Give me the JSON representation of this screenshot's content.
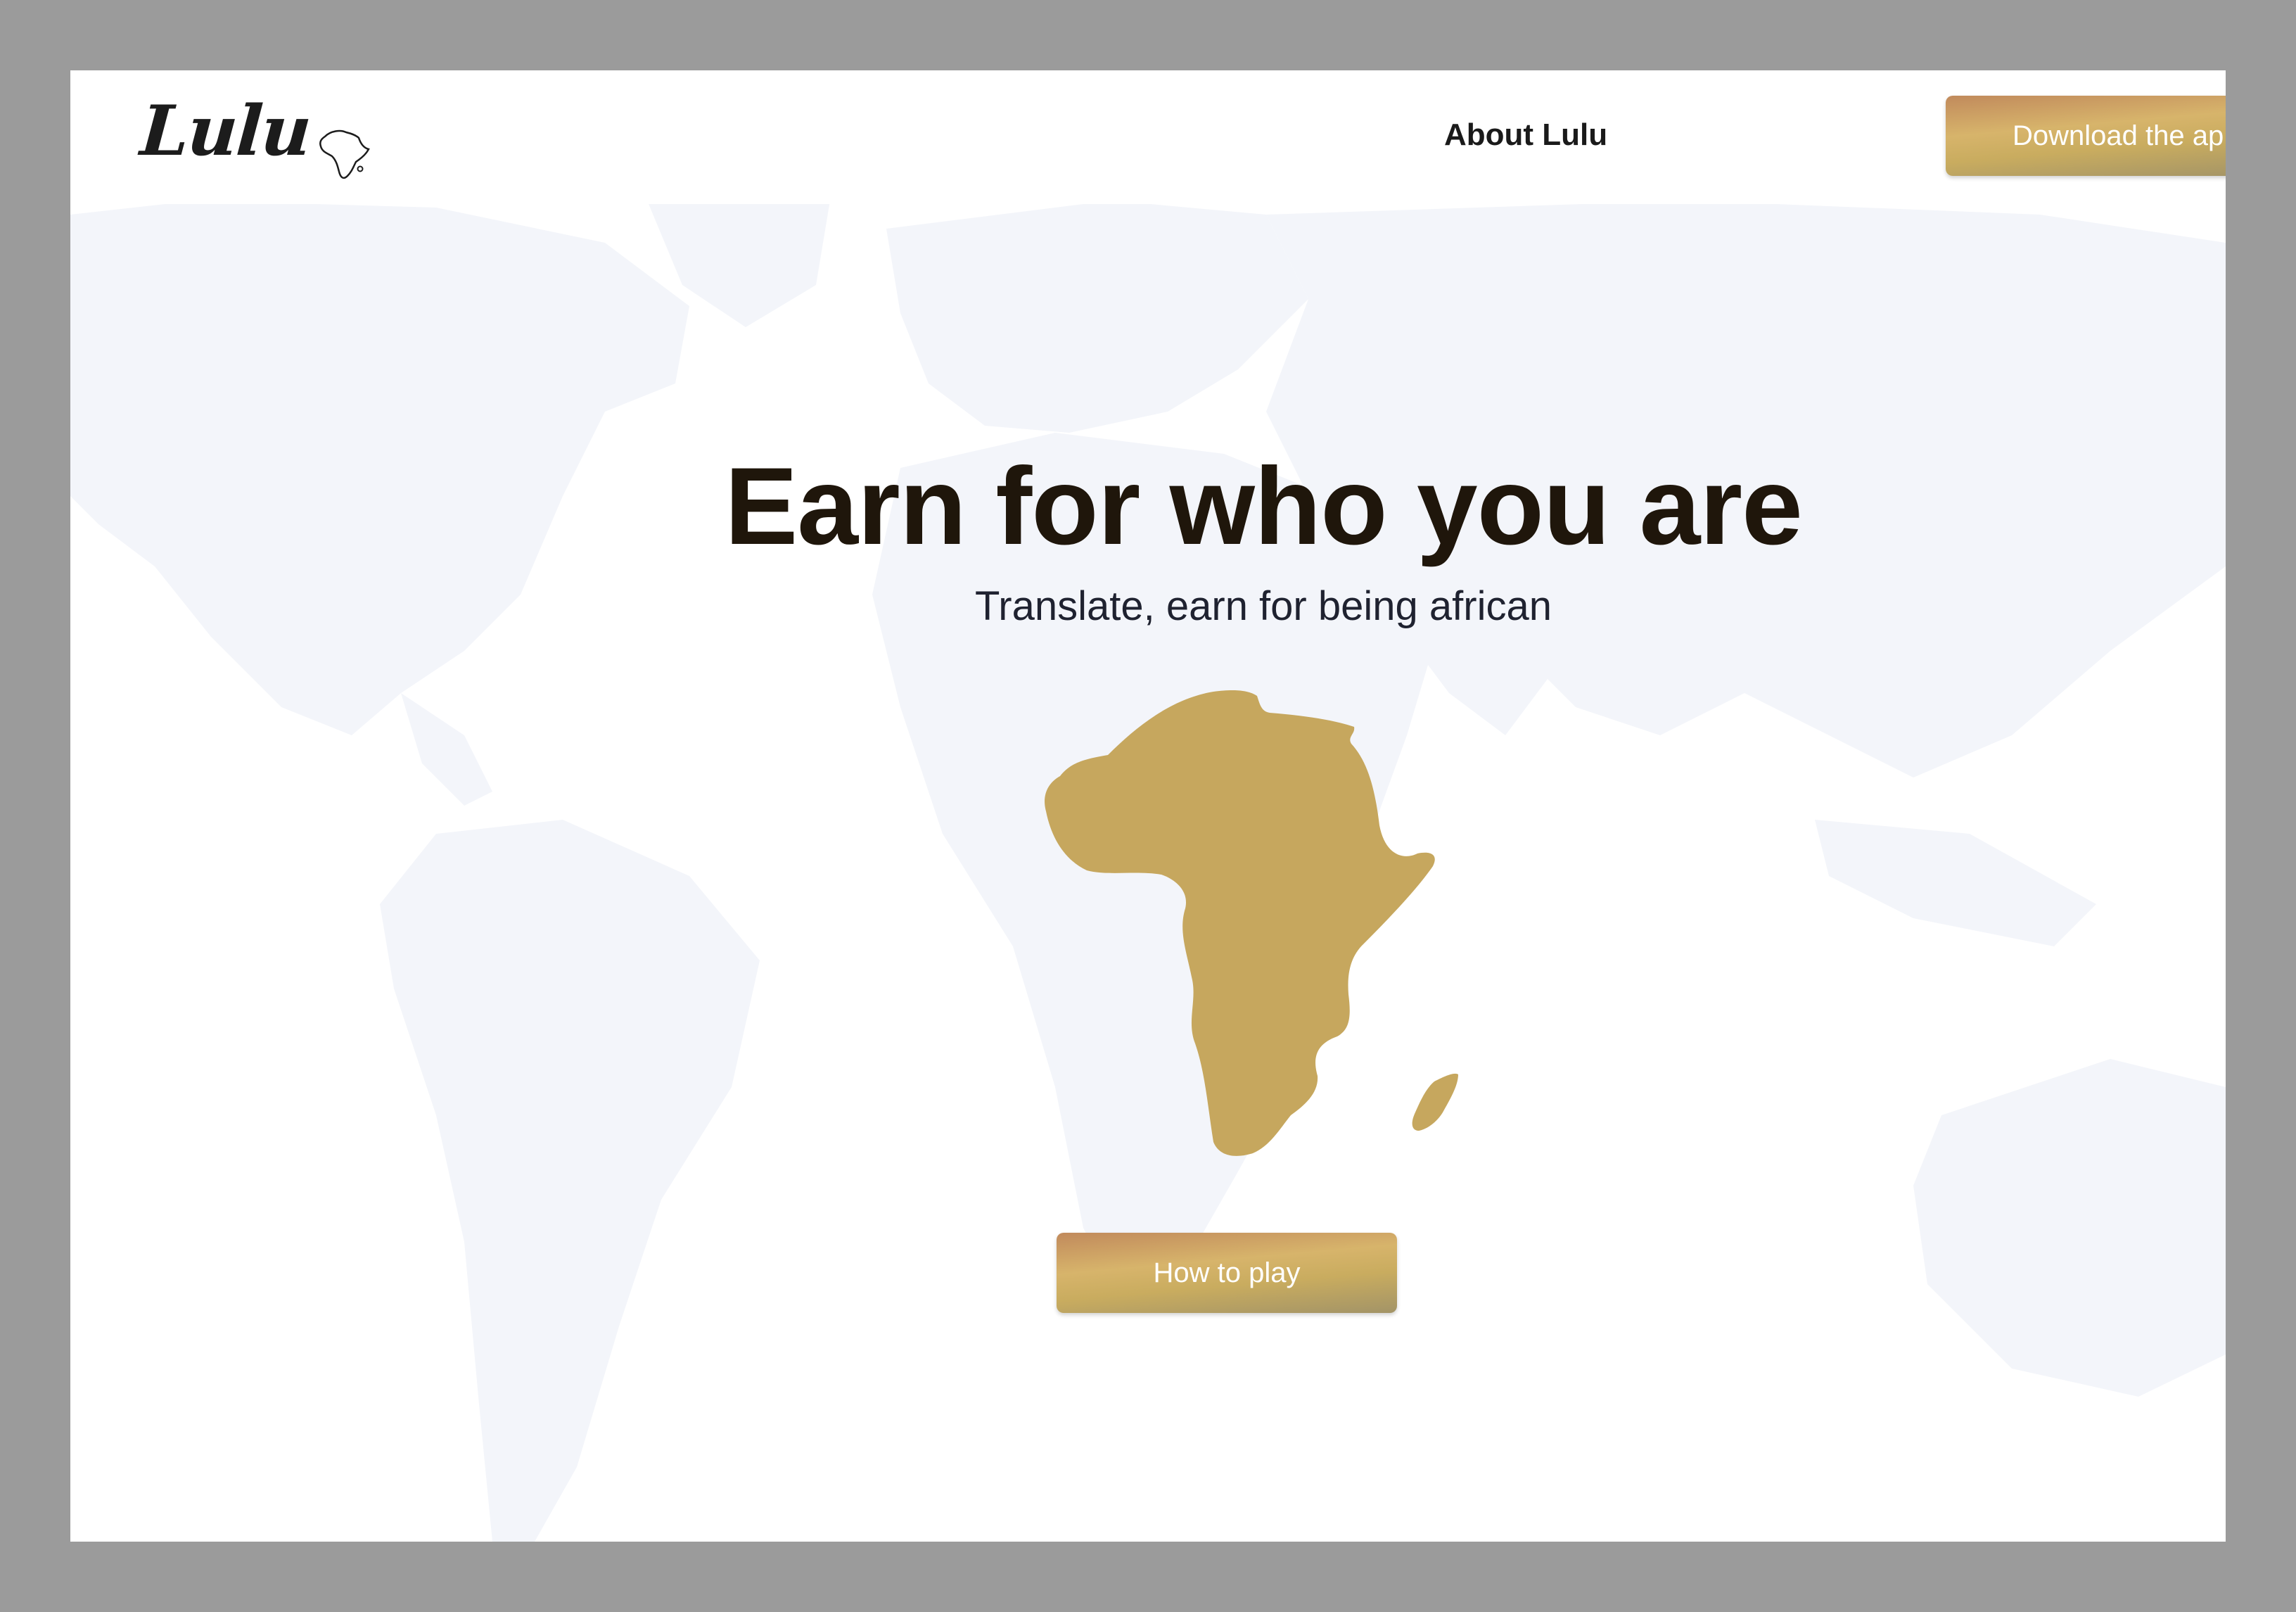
{
  "nav": {
    "logo_text": "Lulu",
    "about_label": "About Lulu",
    "download_label": "Download the ap"
  },
  "hero": {
    "title": "Earn for who you are",
    "subtitle": "Translate, earn for being african",
    "cta_label": "How to play"
  },
  "colors": {
    "gold": "#c6a75e",
    "button_gradient": [
      "#c18a5c",
      "#d7b46b",
      "#a39467"
    ],
    "headline": "#1f160b",
    "map_shade": "#f3f5fa"
  },
  "icons": {
    "logo_mark": "africa-outline-icon",
    "hero_graphic": "africa-map-icon"
  }
}
